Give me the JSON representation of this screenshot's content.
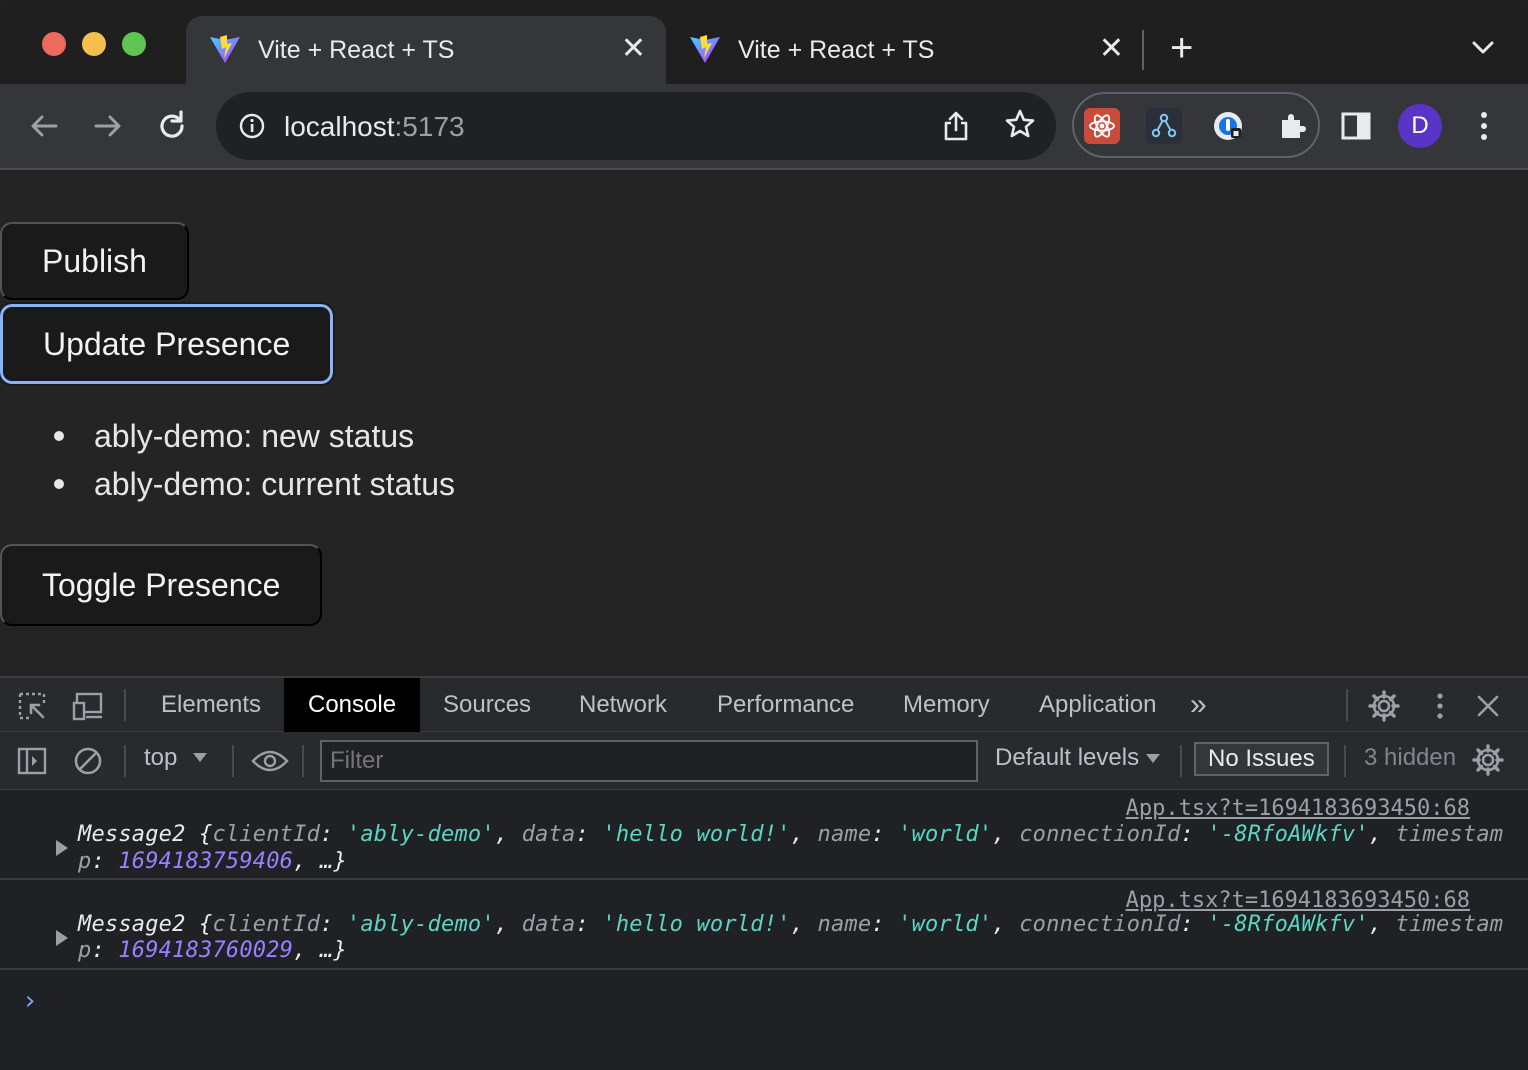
{
  "browser": {
    "tabs": [
      {
        "title": "Vite + React + TS",
        "close": "✕"
      },
      {
        "title": "Vite + React + TS",
        "close": "✕"
      }
    ],
    "new_tab": "+",
    "url_host": "localhost",
    "url_port": ":5173",
    "avatar_letter": "D"
  },
  "page": {
    "publish_label": "Publish",
    "update_presence_label": "Update Presence",
    "presence_items": [
      "ably-demo: new status",
      "ably-demo: current status"
    ],
    "toggle_presence_label": "Toggle Presence"
  },
  "devtools": {
    "tabs": [
      "Elements",
      "Console",
      "Sources",
      "Network",
      "Performance",
      "Memory",
      "Application"
    ],
    "more": "»",
    "context": "top",
    "filter_placeholder": "Filter",
    "levels": "Default levels",
    "issues": "No Issues",
    "hidden": "3 hidden",
    "messages": [
      {
        "source": "App.tsx?t=1694183693450:68",
        "class_name": "Message2",
        "clientId": "'ably-demo'",
        "data": "'hello world!'",
        "name": "'world'",
        "connectionId": "'-8RfoAWkfv'",
        "timestamp": "1694183759406",
        "key_timestamp_a": "timestam",
        "key_timestamp_b": "p"
      },
      {
        "source": "App.tsx?t=1694183693450:68",
        "class_name": "Message2",
        "clientId": "'ably-demo'",
        "data": "'hello world!'",
        "name": "'world'",
        "connectionId": "'-8RfoAWkfv'",
        "timestamp": "1694183760029",
        "key_timestamp_a": "timestam",
        "key_timestamp_b": "p"
      }
    ],
    "prompt": "›"
  },
  "colors": {
    "focus_ring": "#8ab4f8",
    "string": "#5cd5c2",
    "number": "#9980ff",
    "avatar": "#5a34c6"
  }
}
